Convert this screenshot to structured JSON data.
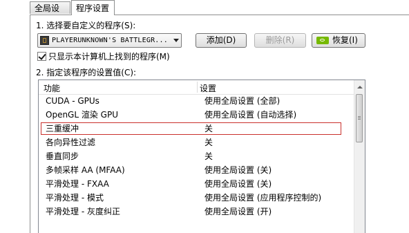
{
  "tabs": [
    {
      "label": "全局设置"
    },
    {
      "label": "程序设置"
    }
  ],
  "step1_label": "1. 选择要自定义的程序(S):",
  "program_select": {
    "value": "PLAYERUNKNOWN'S BATTLEGR...",
    "icon": "game-app-icon"
  },
  "buttons": {
    "add": "添加(D)",
    "delete": "删除(R)",
    "restore": "恢复(I)"
  },
  "checkbox": {
    "label": "只显示本计算机上找到的程序(M)",
    "checked": true
  },
  "step2_label": "2. 指定该程序的设置值(C):",
  "table": {
    "headers": [
      "功能",
      "设置"
    ],
    "rows": [
      {
        "feature": "CUDA - GPUs",
        "setting": "使用全局设置 (全部)"
      },
      {
        "feature": "OpenGL 渲染 GPU",
        "setting": "使用全局设置 (自动选择)"
      },
      {
        "feature": "三重缓冲",
        "setting": "关",
        "selected": true
      },
      {
        "feature": "各向异性过滤",
        "setting": "关"
      },
      {
        "feature": "垂直同步",
        "setting": "关"
      },
      {
        "feature": "多帧采样 AA (MFAA)",
        "setting": "使用全局设置 (关)"
      },
      {
        "feature": "平滑处理 - FXAA",
        "setting": "使用全局设置 (关)"
      },
      {
        "feature": "平滑处理 - 模式",
        "setting": "使用全局设置 (应用程序控制的)"
      },
      {
        "feature": "平滑处理 - 灰度纠正",
        "setting": "使用全局设置 (开)"
      }
    ]
  },
  "colors": {
    "selection_outline": "#c9302c",
    "nvidia_green": "#76b900"
  }
}
